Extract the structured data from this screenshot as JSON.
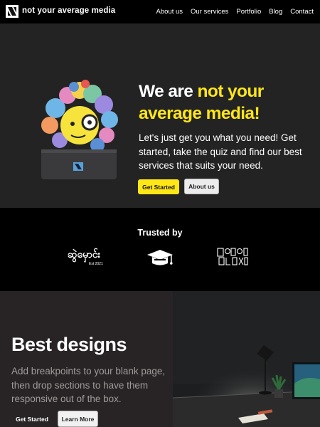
{
  "nav": {
    "brand": "not your average media",
    "links": [
      "About us",
      "Our services",
      "Portfolio",
      "Blog",
      "Contact"
    ]
  },
  "hero": {
    "title_part1": "We are ",
    "title_highlight": "not your average media!",
    "description": "Let's just get you what you need! Get started, take the quiz and find our best services that suits your need.",
    "primary_button": "Get Started",
    "secondary_button": "About us"
  },
  "trusted": {
    "title": "Trusted by",
    "logo1_text": "ဆွဲမှောင်း",
    "logo1_sub": "Est 2021"
  },
  "design": {
    "title": "Best designs",
    "description": "Add breakpoints to your blank page, then drop sections to have them responsive out of the box.",
    "primary_button": "Get Started",
    "secondary_button": "Learn More"
  },
  "colors": {
    "accent": "#ffe617",
    "hero_bg": "#232323",
    "nav_bg": "#000000",
    "design_bg": "#282425"
  }
}
